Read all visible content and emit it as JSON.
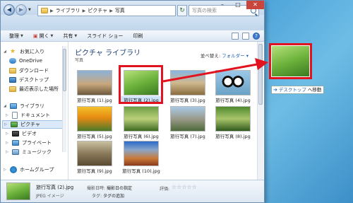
{
  "address_bar": {
    "crumbs": [
      "ライブラリ",
      "ピクチャ",
      "写真"
    ]
  },
  "search": {
    "placeholder": "写真の検索"
  },
  "toolbar": {
    "organize": "整理",
    "open": "開く",
    "share": "共有",
    "slideshow": "スライド ショー",
    "print": "印刷"
  },
  "sidebar": {
    "favorites": "お気に入り",
    "onedrive": "OneDrive",
    "downloads": "ダウンロード",
    "desktop": "デスクトップ",
    "recent": "最近表示した場所",
    "libraries": "ライブラリ",
    "documents": "ドキュメント",
    "pictures": "ピクチャ",
    "videos": "ビデオ",
    "private": "プライベート",
    "music": "ミュージック",
    "homegroup": "ホームグループ"
  },
  "content": {
    "title": "ピクチャ ライブラリ",
    "subtitle": "写真",
    "arrange_label": "並べ替え:",
    "arrange_value": "フォルダー",
    "files": [
      "旅行写真 (1).jpg",
      "旅行写真 (2).jpg",
      "旅行写真 (3).jpg",
      "旅行写真 (4).jpg",
      "旅行写真 (5).jpg",
      "旅行写真 (6).jpg",
      "旅行写真 (7).jpg",
      "旅行写真 (8).jpg",
      "旅行写真 (9).jpg",
      "旅行写真 (10).jpg"
    ],
    "selected_index": 1
  },
  "details": {
    "name": "旅行写真 (2).jpg",
    "type": "JPEG イメージ",
    "date_label": "撮影日時:",
    "date_value": "撮影日の指定",
    "tag_label": "タグ:",
    "tag_value": "タグの追加",
    "rating_label": "評価:",
    "stars": "☆☆☆☆☆"
  },
  "drag": {
    "tip_target": "デスクトップ",
    "tip_action": "へ移動"
  },
  "colors": {
    "highlight": "#e0131f",
    "link": "#1a5fb4"
  }
}
